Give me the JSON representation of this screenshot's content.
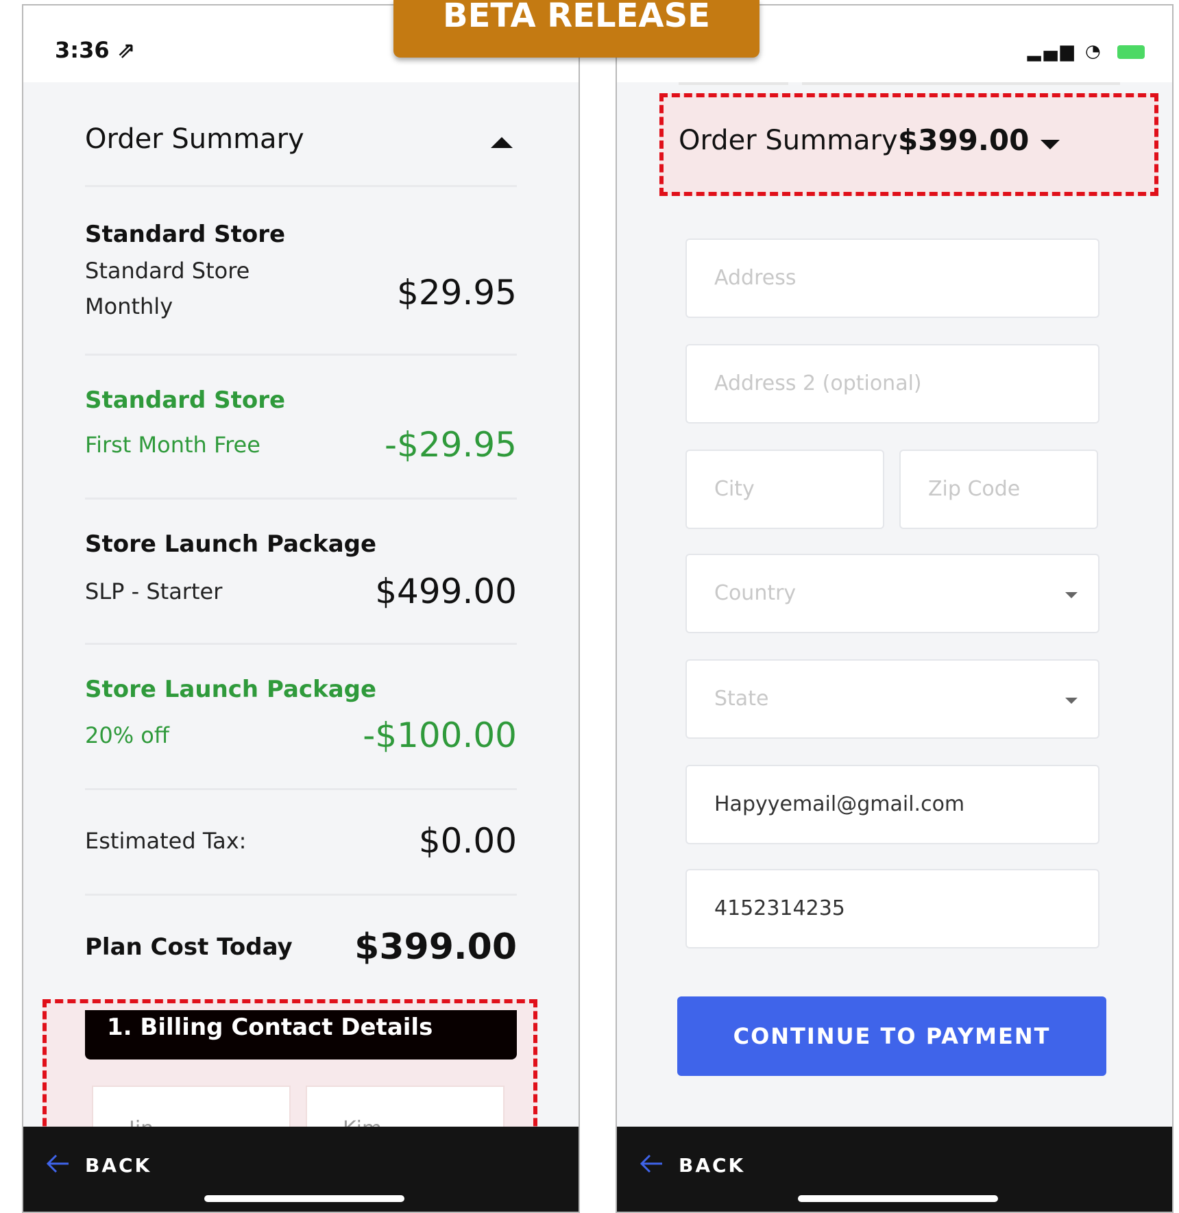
{
  "banner": {
    "text": "BETA RELEASE"
  },
  "left": {
    "status": {
      "time": "3:36 ⇗"
    },
    "summary": {
      "title": "Order Summary",
      "items": [
        {
          "title": "Standard Store",
          "line1": "Standard Store",
          "line2": "Monthly",
          "price": "$29.95"
        },
        {
          "title": "Standard Store",
          "line1": "First Month Free",
          "price": "-$29.95"
        },
        {
          "title": "Store Launch Package",
          "line1": "SLP - Starter",
          "price": "$499.00"
        },
        {
          "title": "Store Launch Package",
          "line1": "20% off",
          "price": "-$100.00"
        }
      ],
      "tax_label": "Estimated Tax:",
      "tax_value": "$0.00",
      "total_label": "Plan Cost Today",
      "total_value": "$399.00"
    },
    "billing": {
      "tab_label": "1. Billing Contact Details",
      "first_name": "Jin",
      "last_name": "Kim"
    },
    "back_label": "BACK"
  },
  "right": {
    "summary": {
      "title": "Order Summary",
      "total": "$399.00"
    },
    "fields": {
      "address_placeholder": "Address",
      "address2_placeholder": "Address 2 (optional)",
      "city_placeholder": "City",
      "zip_placeholder": "Zip Code",
      "country_placeholder": "Country",
      "state_placeholder": "State",
      "email_value": "Hapyyemail@gmail.com",
      "phone_value": "4152314235"
    },
    "cta_label": "CONTINUE TO PAYMENT",
    "back_label": "BACK"
  },
  "colors": {
    "banner": "#c47a12",
    "accent_green": "#2f9a3b",
    "cta_blue": "#3f64ea",
    "highlight_red": "#e0101a"
  },
  "icons": [
    "navigation-arrow-icon",
    "signal-icon",
    "wifi-icon",
    "battery-icon",
    "chevron-up-icon",
    "chevron-down-icon",
    "back-arrow-icon"
  ]
}
